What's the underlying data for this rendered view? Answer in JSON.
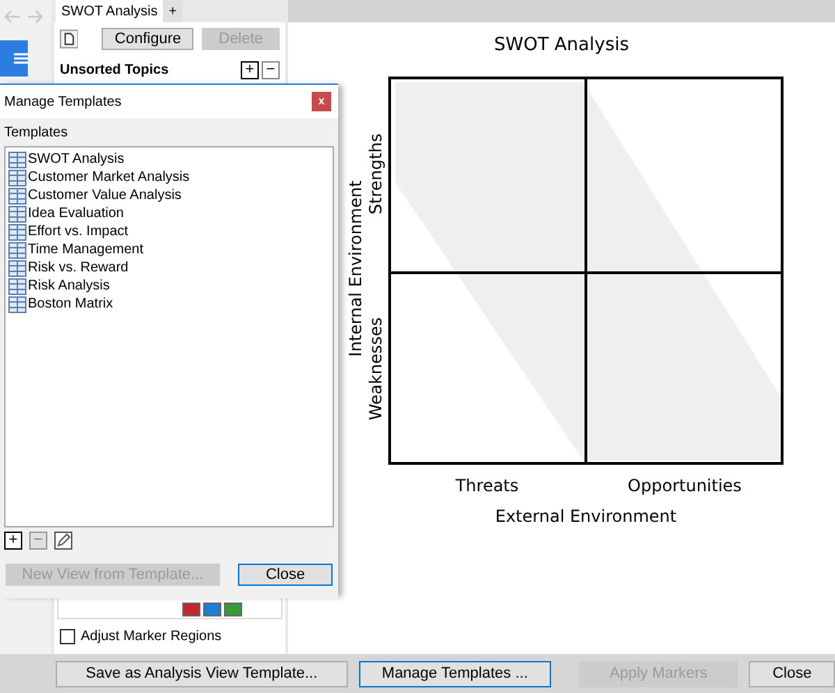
{
  "tabs": [
    {
      "label": "SWOT Analysis",
      "selected": true
    },
    {
      "label": "+",
      "selected": false
    }
  ],
  "panel": {
    "configure": {
      "label": "Configure"
    },
    "delete": {
      "label": "Delete",
      "disabled": true
    },
    "section_title": "Unsorted Topics",
    "add": "+",
    "remove": "−",
    "marker_colors": [
      {
        "color": "#c0282d"
      },
      {
        "color": "#1e7fd0"
      },
      {
        "color": "#3a9a3a"
      }
    ],
    "adjust_marker_regions": {
      "label": "Adjust Marker Regions",
      "checked": false
    }
  },
  "diagram": {
    "title": "SWOT Analysis",
    "y_axis": "Internal Environment",
    "x_axis": "External Environment",
    "rows": [
      "Strengths",
      "Weaknesses"
    ],
    "columns": [
      "Threats",
      "Opportunities"
    ]
  },
  "dialog": {
    "title": "Manage Templates",
    "close": "x",
    "list_label": "Templates",
    "templates": [
      "SWOT Analysis",
      "Customer Market Analysis",
      "Customer Value Analysis",
      "Idea Evaluation",
      "Effort vs. Impact",
      "Time Management",
      "Risk vs. Reward",
      "Risk Analysis",
      "Boston Matrix"
    ],
    "add": "+",
    "remove": "−",
    "new_view": {
      "label": "New View from Template...",
      "disabled": true
    },
    "close_button": {
      "label": "Close",
      "focused": true
    }
  },
  "bottom_buttons": [
    {
      "label": "Save as Analysis View Template...",
      "disabled": false,
      "focused": false
    },
    {
      "label": "Manage Templates ...",
      "disabled": false,
      "focused": true
    },
    {
      "label": "Apply Markers",
      "disabled": true,
      "focused": false
    },
    {
      "label": "Close",
      "disabled": false,
      "focused": false
    }
  ]
}
